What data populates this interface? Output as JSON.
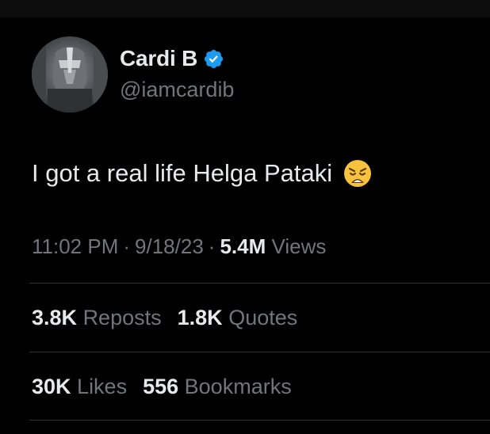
{
  "user": {
    "display_name": "Cardi B",
    "handle": "@iamcardib",
    "verified": true
  },
  "tweet": {
    "text": "I got a real life Helga Pataki",
    "emoji": "weary-face-emoji"
  },
  "meta": {
    "time": "11:02 PM",
    "date": "9/18/23",
    "views_count": "5.4M",
    "views_label": "Views"
  },
  "stats": {
    "reposts_count": "3.8K",
    "reposts_label": "Reposts",
    "quotes_count": "1.8K",
    "quotes_label": "Quotes",
    "likes_count": "30K",
    "likes_label": "Likes",
    "bookmarks_count": "556",
    "bookmarks_label": "Bookmarks"
  },
  "colors": {
    "background": "#000000",
    "primary_text": "#e7e9ea",
    "secondary_text": "#71767b",
    "verified_blue": "#1d9bf0",
    "divider": "#2f3336"
  }
}
